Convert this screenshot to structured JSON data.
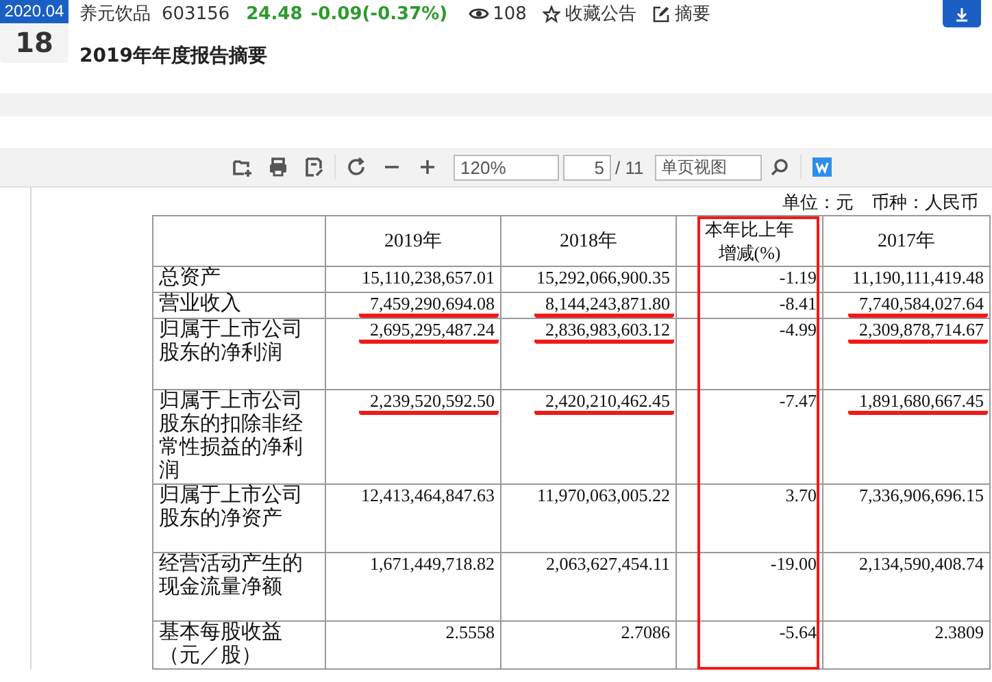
{
  "header": {
    "date": {
      "month": "2020.04",
      "day": "18"
    },
    "company": "养元饮品",
    "code": "603156",
    "price": "24.48",
    "change": "-0.09(-0.37%)",
    "views": "108",
    "favorite": "收藏公告",
    "summary": "摘要",
    "title": "2019年年度报告摘要"
  },
  "toolbar": {
    "zoom": "120%",
    "page": "5",
    "total": "/ 11",
    "view_mode": "单页视图"
  },
  "document": {
    "unit_note": "单位：元　币种：人民币",
    "table": {
      "columns": [
        {
          "title": "2019年",
          "highlighted": false
        },
        {
          "title": "2018年",
          "highlighted": false
        },
        {
          "title": "本年比上年增减(%)",
          "highlighted": true
        },
        {
          "title": "2017年",
          "highlighted": false
        }
      ],
      "rows": [
        {
          "label": "总资产",
          "values": [
            "15,110,238,657.01",
            "15,292,066,900.35",
            "-1.19",
            "11,190,111,419.48"
          ],
          "underlined": [
            false,
            false,
            false,
            false
          ]
        },
        {
          "label": "营业收入",
          "values": [
            "7,459,290,694.08",
            "8,144,243,871.80",
            "-8.41",
            "7,740,584,027.64"
          ],
          "underlined": [
            true,
            true,
            false,
            true
          ]
        },
        {
          "label": "归属于上市公司股东的净利润",
          "values": [
            "2,695,295,487.24",
            "2,836,983,603.12",
            "-4.99",
            "2,309,878,714.67"
          ],
          "underlined": [
            true,
            true,
            false,
            true
          ]
        },
        {
          "label": "归属于上市公司股东的扣除非经常性损益的净利润",
          "values": [
            "2,239,520,592.50",
            "2,420,210,462.45",
            "-7.47",
            "1,891,680,667.45"
          ],
          "underlined": [
            true,
            true,
            false,
            true
          ]
        },
        {
          "label": "归属于上市公司股东的净资产",
          "values": [
            "12,413,464,847.63",
            "11,970,063,005.22",
            "3.70",
            "7,336,906,696.15"
          ],
          "underlined": [
            false,
            false,
            false,
            false
          ]
        },
        {
          "label": "经营活动产生的现金流量净额",
          "values": [
            "1,671,449,718.82",
            "2,063,627,454.11",
            "-19.00",
            "2,134,590,408.74"
          ],
          "underlined": [
            false,
            false,
            false,
            false
          ]
        },
        {
          "label": "基本每股收益（元／股）",
          "values": [
            "2.5558",
            "2.7086",
            "-5.64",
            "2.3809"
          ],
          "underlined": [
            false,
            false,
            false,
            false
          ]
        }
      ]
    }
  }
}
